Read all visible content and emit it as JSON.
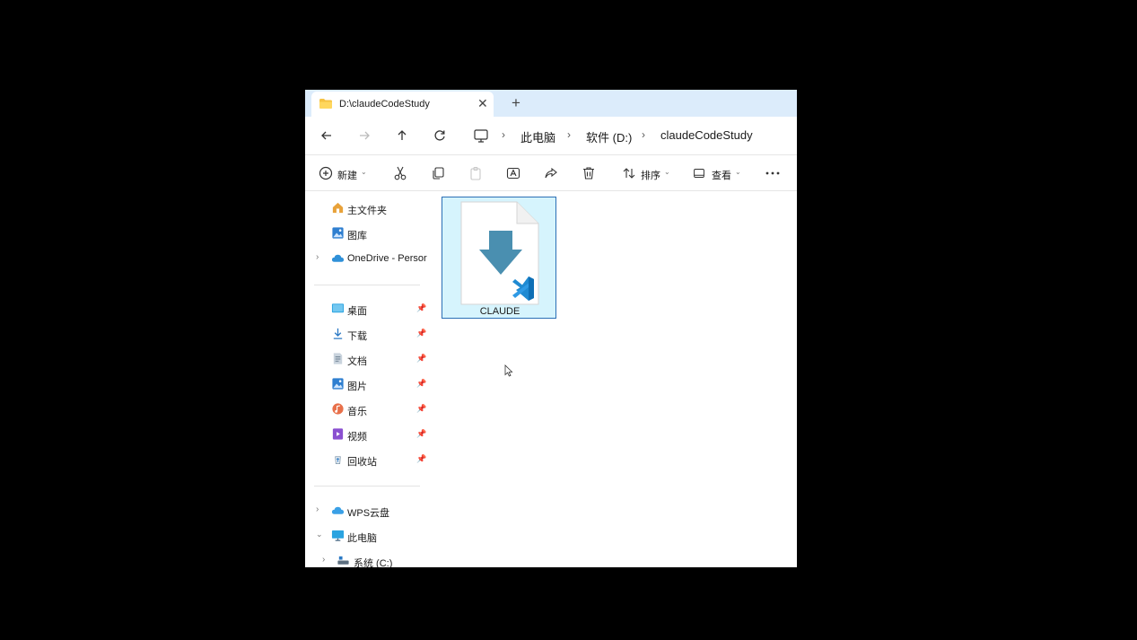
{
  "tab": {
    "title": "D:\\claudeCodeStudy",
    "close_icon": "close-icon",
    "new_tab_icon": "plus-icon"
  },
  "address": {
    "crumbs": [
      "此电脑",
      "软件 (D:)",
      "claudeCodeStudy"
    ]
  },
  "commands": {
    "new_label": "新建",
    "sort_label": "排序",
    "view_label": "查看"
  },
  "sidebar": {
    "top": [
      {
        "label": "主文件夹",
        "icon": "home-icon"
      },
      {
        "label": "图库",
        "icon": "gallery-icon"
      },
      {
        "label": "OneDrive - Persor",
        "icon": "cloud-icon"
      }
    ],
    "pinned": [
      {
        "label": "桌面",
        "icon": "desktop-icon"
      },
      {
        "label": "下载",
        "icon": "download-icon"
      },
      {
        "label": "文档",
        "icon": "document-icon"
      },
      {
        "label": "图片",
        "icon": "pictures-icon"
      },
      {
        "label": "音乐",
        "icon": "music-icon"
      },
      {
        "label": "视频",
        "icon": "video-icon"
      },
      {
        "label": "回收站",
        "icon": "recycle-bin-icon"
      }
    ],
    "bottom": [
      {
        "label": "WPS云盘",
        "icon": "cloud-icon"
      },
      {
        "label": "此电脑",
        "icon": "computer-icon"
      },
      {
        "label": "系统 (C:)",
        "icon": "drive-icon"
      }
    ]
  },
  "files": [
    {
      "name": "CLAUDE",
      "selected": true
    }
  ],
  "colors": {
    "tabbar": "#dcecfb",
    "selection_fill": "#d6f4fd",
    "selection_border": "#2b6fb5",
    "file_arrow": "#4a8fb0",
    "vscode_blue": "#1f8ad2"
  }
}
